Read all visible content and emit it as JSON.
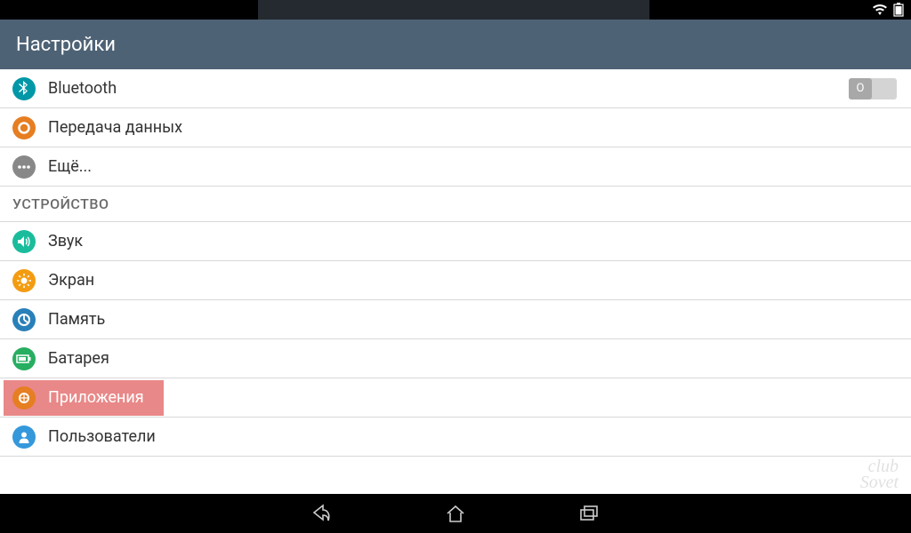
{
  "statusbar": {
    "overlay_text": ""
  },
  "header": {
    "title": "Настройки"
  },
  "rows": {
    "bluetooth": {
      "label": "Bluetooth",
      "toggle": "O"
    },
    "data": {
      "label": "Передача данных"
    },
    "more": {
      "label": "Ещё..."
    }
  },
  "section": {
    "device": "УСТРОЙСТВО"
  },
  "device_rows": {
    "sound": {
      "label": "Звук"
    },
    "display": {
      "label": "Экран"
    },
    "storage": {
      "label": "Память"
    },
    "battery": {
      "label": "Батарея"
    },
    "apps": {
      "label": "Приложения"
    },
    "users": {
      "label": "Пользователи"
    }
  },
  "watermark": {
    "line1": "club",
    "line2": "Sovet"
  }
}
